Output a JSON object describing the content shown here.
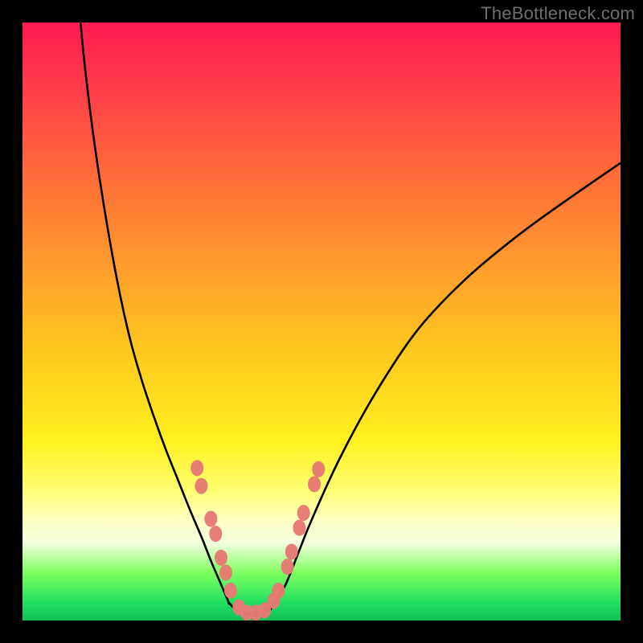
{
  "watermark": {
    "text": "TheBottleneck.com"
  },
  "colors": {
    "background": "#000000",
    "curve": "#000000",
    "marker_fill": "#e77a73",
    "marker_stroke": "#c45a52"
  },
  "chart_data": {
    "type": "line",
    "title": "",
    "xlabel": "",
    "ylabel": "",
    "xlim": [
      0,
      100
    ],
    "ylim": [
      0,
      100
    ],
    "grid": false,
    "series": [
      {
        "name": "left-arm",
        "x": [
          9.7,
          10.5,
          12,
          14,
          16,
          18,
          20,
          22,
          24,
          26,
          28,
          30,
          31.5,
          33,
          34.5
        ],
        "values": [
          100,
          92,
          80,
          67,
          56,
          47,
          40,
          34,
          28.5,
          23.5,
          18.5,
          13.8,
          10,
          6.5,
          3
        ]
      },
      {
        "name": "bottom",
        "x": [
          34.5,
          36,
          38,
          40,
          41.5
        ],
        "values": [
          3,
          1.5,
          1,
          1.5,
          2
        ]
      },
      {
        "name": "right-arm",
        "x": [
          41.5,
          44,
          48,
          53,
          59,
          66,
          74,
          83,
          92,
          100
        ],
        "values": [
          2,
          6,
          16,
          27,
          38,
          48.5,
          57,
          64.5,
          71,
          76.5
        ]
      }
    ],
    "markers": [
      {
        "x": 29.2,
        "y": 25.5
      },
      {
        "x": 29.9,
        "y": 22.5
      },
      {
        "x": 31.5,
        "y": 17
      },
      {
        "x": 32.3,
        "y": 14.5
      },
      {
        "x": 33.2,
        "y": 10.5
      },
      {
        "x": 34.0,
        "y": 8
      },
      {
        "x": 34.8,
        "y": 5
      },
      {
        "x": 36.2,
        "y": 2.2
      },
      {
        "x": 37.5,
        "y": 1.3
      },
      {
        "x": 39.0,
        "y": 1.3
      },
      {
        "x": 40.5,
        "y": 1.7
      },
      {
        "x": 42.0,
        "y": 3.3
      },
      {
        "x": 42.8,
        "y": 5
      },
      {
        "x": 44.3,
        "y": 9
      },
      {
        "x": 45.0,
        "y": 11.5
      },
      {
        "x": 46.3,
        "y": 15.5
      },
      {
        "x": 47.0,
        "y": 18
      },
      {
        "x": 48.8,
        "y": 22.8
      },
      {
        "x": 49.5,
        "y": 25.3
      }
    ]
  }
}
